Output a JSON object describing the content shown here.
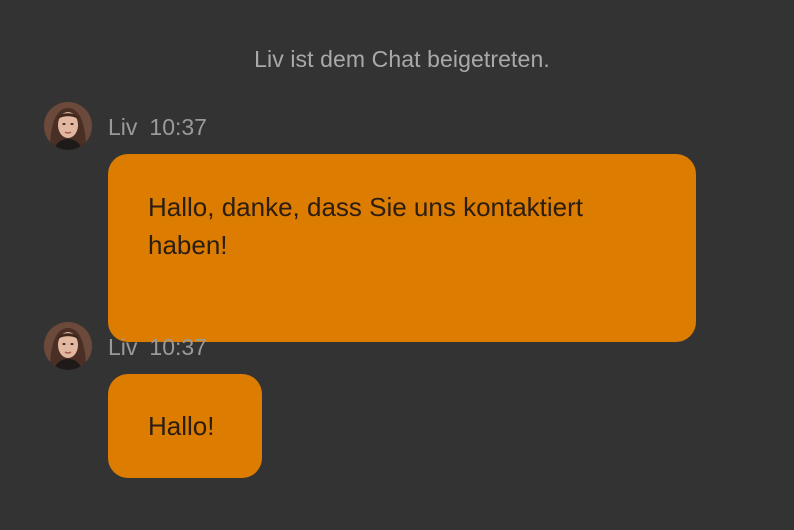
{
  "system": {
    "joined_text": "Liv ist dem Chat beigetreten."
  },
  "messages": [
    {
      "sender": "Liv",
      "time": "10:37",
      "avatar_icon": "agent-avatar-icon",
      "text": "Hallo, danke, dass Sie uns kontaktiert haben!"
    },
    {
      "sender": "Liv",
      "time": "10:37",
      "avatar_icon": "agent-avatar-icon",
      "text": "Hallo!"
    }
  ],
  "colors": {
    "background": "#333333",
    "bubble": "#dc7c00",
    "bubble_text": "#2b1d10",
    "meta_text": "#9a9a9a",
    "system_text": "#a9a9a9"
  }
}
